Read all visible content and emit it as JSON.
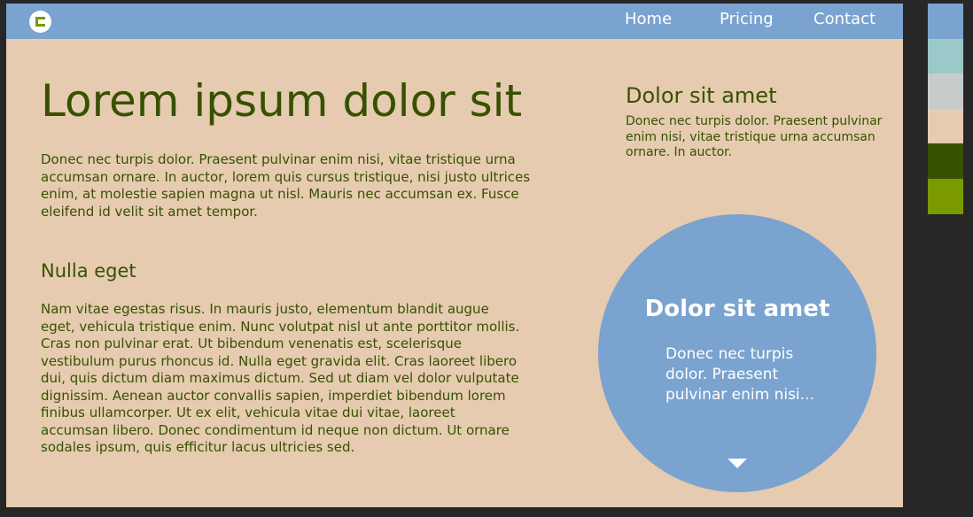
{
  "nav": {
    "logo_icon": "c-logo-icon",
    "links": [
      "Home",
      "Pricing",
      "Contact"
    ]
  },
  "hero": {
    "title": "Lorem ipsum dolor sit",
    "text": "Donec nec turpis dolor. Praesent pulvinar enim nisi, vitae tristique urna accumsan ornare. In auctor, lorem quis cursus tristique, nisi justo ultrices enim, at molestie sapien magna ut nisl. Mauris nec accumsan ex. Fusce eleifend id velit sit amet tempor."
  },
  "section": {
    "heading": "Nulla eget",
    "text": "Nam vitae egestas risus. In mauris justo, elementum blandit augue eget, vehicula tristique enim. Nunc volutpat nisl ut ante porttitor mollis. Cras non pulvinar erat. Ut bibendum venenatis est, scelerisque vestibulum purus rhoncus id. Nulla eget gravida elit. Cras laoreet libero dui, quis dictum diam maximus dictum. Sed ut diam vel dolor vulputate dignissim. Aenean auctor convallis sapien, imperdiet bibendum lorem finibus ullamcorper. Ut ex elit, vehicula vitae dui vitae, laoreet accumsan libero. Donec condimentum id neque non dictum. Ut ornare sodales ipsum, quis efficitur lacus ultricies sed."
  },
  "aside": {
    "heading": "Dolor sit amet",
    "text": "Donec nec turpis dolor. Praesent pulvinar enim nisi, vitae tristique urna accumsan ornare. In auctor."
  },
  "circle": {
    "heading": "Dolor sit amet",
    "text": "Donec nec turpis dolor. Praesent pulvinar enim nisi...",
    "arrow_icon": "chevron-down-icon"
  },
  "palette": [
    "#7aa3cf",
    "#9bc8c8",
    "#c6cccb",
    "#e6cbb0",
    "#375100",
    "#7a9a00"
  ]
}
